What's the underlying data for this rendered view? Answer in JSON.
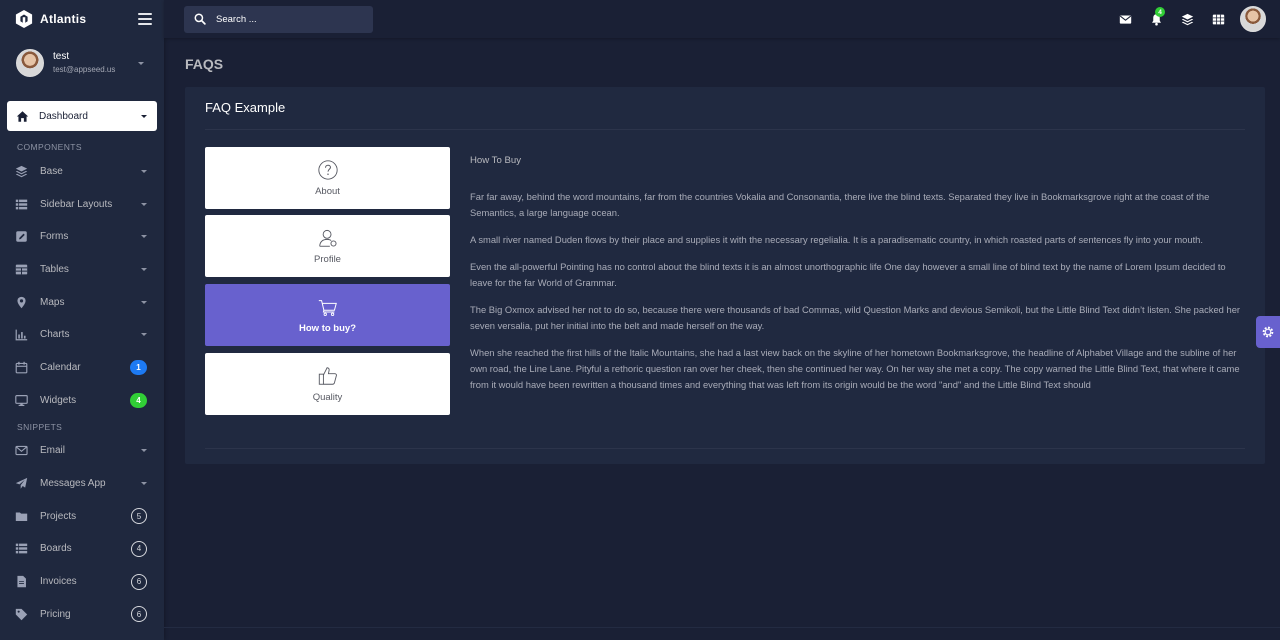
{
  "app": {
    "name": "Atlantis"
  },
  "user": {
    "name": "test",
    "email": "test@appseed.us"
  },
  "sidebar": {
    "active": {
      "label": "Dashboard",
      "icon": "home-icon"
    },
    "section_components": "COMPONENTS",
    "components": [
      {
        "label": "Base",
        "icon": "layers-icon",
        "badge": ""
      },
      {
        "label": "Sidebar Layouts",
        "icon": "list-icon",
        "badge": ""
      },
      {
        "label": "Forms",
        "icon": "pen-square-icon",
        "badge": ""
      },
      {
        "label": "Tables",
        "icon": "table-icon",
        "badge": ""
      },
      {
        "label": "Maps",
        "icon": "map-marker-icon",
        "badge": ""
      },
      {
        "label": "Charts",
        "icon": "chart-bar-icon",
        "badge": ""
      },
      {
        "label": "Calendar",
        "icon": "calendar-icon",
        "badge": "1"
      },
      {
        "label": "Widgets",
        "icon": "desktop-icon",
        "badge": "4"
      }
    ],
    "section_snippets": "SNIPPETS",
    "snippets": [
      {
        "label": "Email",
        "icon": "envelope-icon",
        "badge": ""
      },
      {
        "label": "Messages App",
        "icon": "paper-plane-icon",
        "badge": ""
      },
      {
        "label": "Projects",
        "icon": "folder-icon",
        "badge": "5"
      },
      {
        "label": "Boards",
        "icon": "list-icon",
        "badge": "4"
      },
      {
        "label": "Invoices",
        "icon": "file-icon",
        "badge": "6"
      },
      {
        "label": "Pricing",
        "icon": "tag-icon",
        "badge": "6"
      }
    ]
  },
  "topbar": {
    "search_placeholder": "Search ...",
    "notification_count": "4"
  },
  "page": {
    "title": "FAQS",
    "card_title": "FAQ Example",
    "tabs": [
      {
        "label": "About",
        "icon": "question-circle-icon",
        "active": false
      },
      {
        "label": "Profile",
        "icon": "user-icon",
        "active": false
      },
      {
        "label": "How to buy?",
        "icon": "shopping-cart-icon",
        "active": true
      },
      {
        "label": "Quality",
        "icon": "thumbs-up-icon",
        "active": false
      }
    ],
    "content": {
      "heading": "How To Buy",
      "paragraphs": [
        "Far far away, behind the word mountains, far from the countries Vokalia and Consonantia, there live the blind texts. Separated they live in Bookmarksgrove right at the coast of the Semantics, a large language ocean.",
        "A small river named Duden flows by their place and supplies it with the necessary regelialia. It is a paradisematic country, in which roasted parts of sentences fly into your mouth.",
        "Even the all-powerful Pointing has no control about the blind texts it is an almost unorthographic life One day however a small line of blind text by the name of Lorem Ipsum decided to leave for the far World of Grammar.",
        "The Big Oxmox advised her not to do so, because there were thousands of bad Commas, wild Question Marks and devious Semikoli, but the Little Blind Text didn’t listen. She packed her seven versalia, put her initial into the belt and made herself on the way.",
        "When she reached the first hills of the Italic Mountains, she had a last view back on the skyline of her hometown Bookmarksgrove, the headline of Alphabet Village and the subline of her own road, the Line Lane. Pityful a rethoric question ran over her cheek, then she continued her way. On her way she met a copy. The copy warned the Little Blind Text, that where it came from it would have been rewritten a thousand times and everything that was left from its origin would be the word \"and\" and the Little Blind Text should"
      ]
    }
  }
}
